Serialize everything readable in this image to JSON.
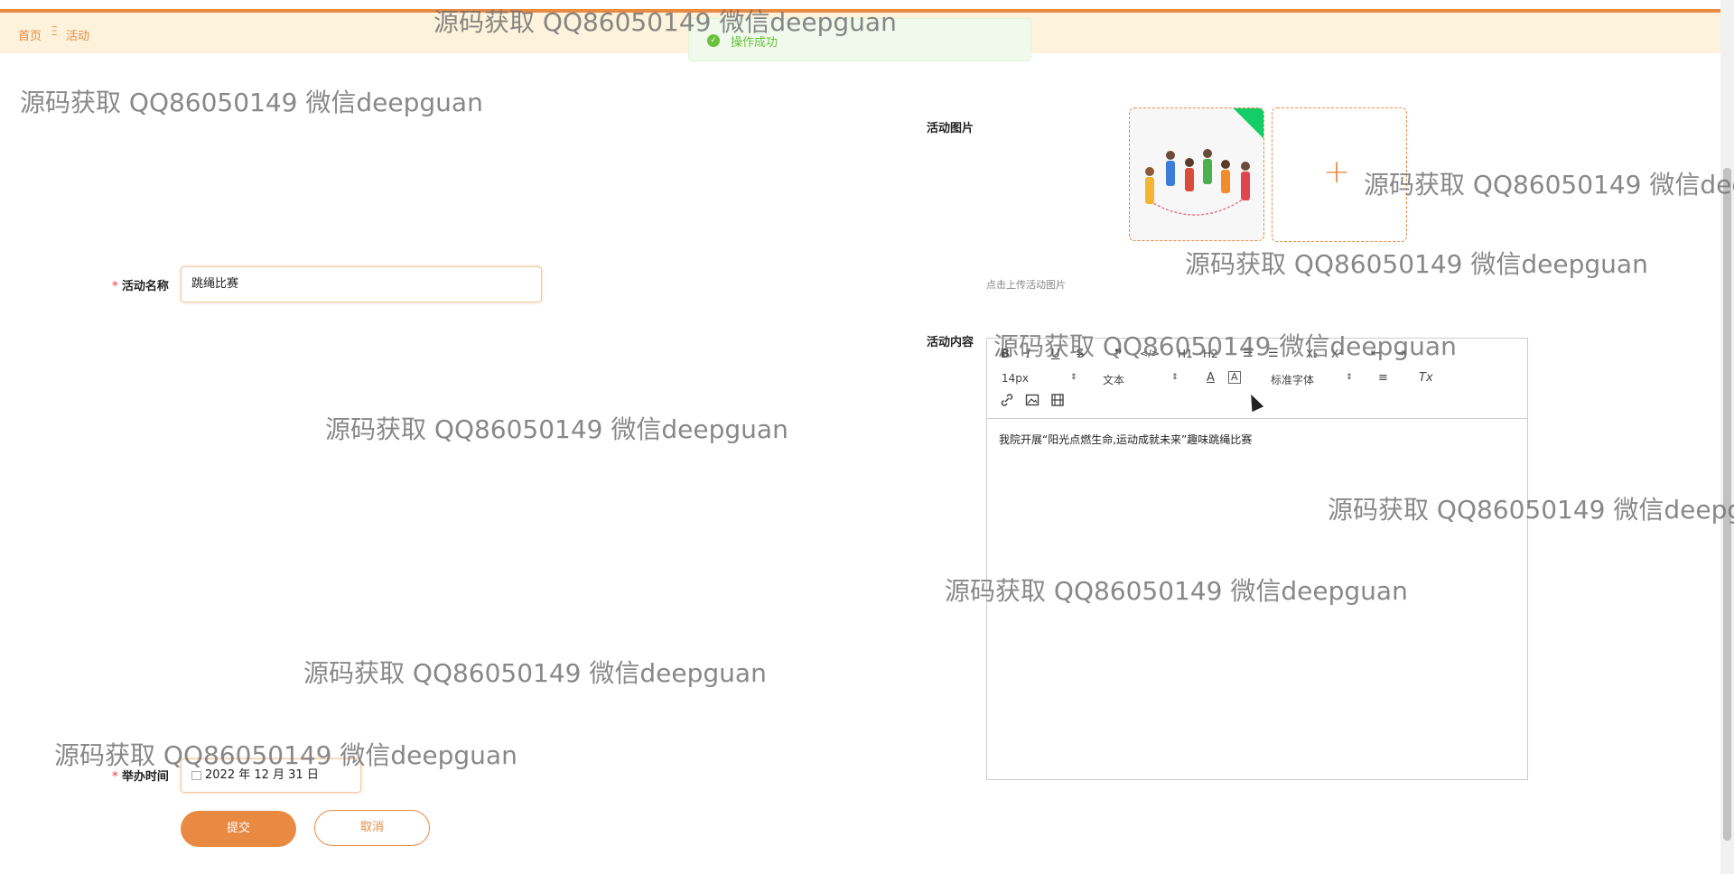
{
  "breadcrumb": {
    "home": "首页",
    "separator": "Ξ",
    "current": "活动"
  },
  "toast": {
    "message": "操作成功",
    "icon": "check-circle-icon"
  },
  "form": {
    "name_label": "活动名称",
    "name_value": "跳绳比赛",
    "image_label": "活动图片",
    "image_hint": "点击上传活动图片",
    "content_label": "活动内容",
    "date_label": "举办时间",
    "date_value": "2022 年 12 月 31 日",
    "required_mark": "*"
  },
  "editor": {
    "buttons": {
      "bold": "B",
      "italic": "I",
      "underline": "U",
      "strike": "S",
      "quote": "❞",
      "code": "</>",
      "h1": "H1",
      "h2": "H2",
      "ol": "☰",
      "ul": "☰",
      "sub": "X₂",
      "sup": "X²",
      "outdent": "⇤",
      "indent": "⇥",
      "color": "A",
      "background": "A",
      "align": "≡",
      "clean": "Tx"
    },
    "size_value": "14px",
    "header_value": "文本",
    "font_value": "标准字体",
    "content": "我院开展“阳光点燃生命,运动成就未来”趣味跳绳比赛"
  },
  "actions": {
    "submit": "提交",
    "cancel": "取消"
  },
  "watermark": "源码获取 QQ86050149 微信deepguan",
  "colors": {
    "accent": "#e98a43",
    "success": "#67c23a",
    "crumb_bg": "#fdf2dc"
  }
}
